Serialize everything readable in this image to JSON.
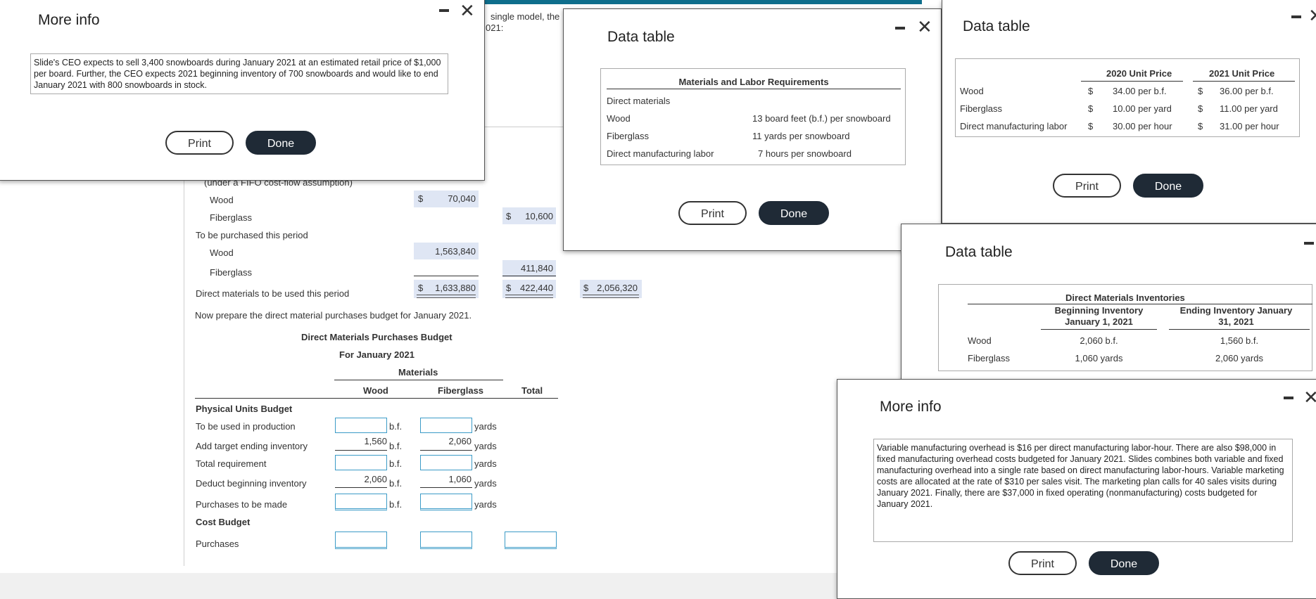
{
  "worksheet": {
    "fragment_intro": "single model, the",
    "fragment_year": "021:",
    "fifo_label": "(under a FIFO cost-flow assumption)",
    "rows_top": {
      "wood_label": "Wood",
      "wood_value_currency": "$",
      "wood_value": "70,040",
      "fiberglass_label": "Fiberglass",
      "fiberglass_currency": "$",
      "fiberglass_value": "10,600",
      "purchase_label": "To be purchased this period",
      "purchase_wood_label": "Wood",
      "purchase_wood_value": "1,563,840",
      "purchase_fiber_label": "Fiberglass",
      "purchase_fiber_value": "411,840",
      "used_label": "Direct materials to be used this period",
      "used_wood_currency": "$",
      "used_wood_value": "1,633,880",
      "used_fiber_currency": "$",
      "used_fiber_value": "422,440",
      "used_total_currency": "$",
      "used_total_value": "2,056,320"
    },
    "instruction": "Now prepare the direct material purchases budget for January 2021.",
    "budget": {
      "title": "Direct Materials Purchases Budget",
      "subtitle": "For January 2021",
      "materials_header": "Materials",
      "col_wood": "Wood",
      "col_fiberglass": "Fiberglass",
      "col_total": "Total",
      "section_physical": "Physical Units Budget",
      "row_used": "To be used in production",
      "row_add_target": "Add target ending inventory",
      "row_total_req": "Total requirement",
      "row_deduct_begin": "Deduct beginning inventory",
      "row_purchases_made": "Purchases to be made",
      "section_cost": "Cost Budget",
      "row_purchases": "Purchases",
      "unit_wood": "b.f.",
      "unit_fiber": "yards",
      "target_wood": "1,560",
      "target_fiber": "2,060",
      "begin_wood": "2,060",
      "begin_fiber": "1,060"
    }
  },
  "dialog_more_info_1": {
    "title": "More info",
    "text": "Slide's CEO expects to sell 3,400 snowboards during January 2021 at an estimated retail price of $1,000 per board. Further, the CEO expects 2021 beginning inventory of 700 snowboards and would like to end January 2021 with 800 snowboards in stock.",
    "print": "Print",
    "done": "Done"
  },
  "dialog_data_table_1": {
    "title": "Data table",
    "table_header": "Materials and Labor Requirements",
    "rows": [
      {
        "label": "Direct materials",
        "value": ""
      },
      {
        "label": "Wood",
        "value": "13 board feet (b.f.) per snowboard"
      },
      {
        "label": "Fiberglass",
        "value": "11 yards per snowboard"
      },
      {
        "label": "Direct manufacturing labor",
        "value": "7 hours per snowboard"
      }
    ],
    "print": "Print",
    "done": "Done"
  },
  "dialog_data_table_2": {
    "title": "Data table",
    "col_2020": "2020 Unit Price",
    "col_2021": "2021 Unit Price",
    "rows": [
      {
        "label": "Wood",
        "c1": "$",
        "v1": "34.00 per b.f.",
        "c2": "$",
        "v2": "36.00 per b.f."
      },
      {
        "label": "Fiberglass",
        "c1": "$",
        "v1": "10.00 per yard",
        "c2": "$",
        "v2": "11.00 per yard"
      },
      {
        "label": "Direct manufacturing labor",
        "c1": "$",
        "v1": "30.00 per hour",
        "c2": "$",
        "v2": "31.00 per hour"
      }
    ],
    "print": "Print",
    "done": "Done"
  },
  "dialog_data_table_3": {
    "title": "Data table",
    "table_header": "Direct Materials Inventories",
    "col_begin_1": "Beginning Inventory",
    "col_begin_2": "January 1, 2021",
    "col_end_1": "Ending Inventory January",
    "col_end_2": "31, 2021",
    "rows": [
      {
        "label": "Wood",
        "begin": "2,060 b.f.",
        "end": "1,560 b.f."
      },
      {
        "label": "Fiberglass",
        "begin": "1,060 yards",
        "end": "2,060 yards"
      }
    ]
  },
  "dialog_more_info_2": {
    "title": "More info",
    "text": "Variable manufacturing overhead is $16 per direct manufacturing labor-hour. There are also $98,000 in fixed manufacturing overhead costs budgeted for January 2021. Slides combines both variable and fixed manufacturing overhead into a single rate based on direct manufacturing labor-hours. Variable marketing costs are allocated at the rate of $310 per sales visit. The marketing plan calls for 40 sales visits during January 2021. Finally, there are $37,000 in fixed operating (nonmanufacturing) costs budgeted for January 2021.",
    "print": "Print",
    "done": "Done"
  },
  "colors": {
    "accent_bar": "#0e6e8c",
    "input_border": "#3b9bc7",
    "highlight": "#dfe6f4",
    "done_button": "#1f2a36"
  }
}
